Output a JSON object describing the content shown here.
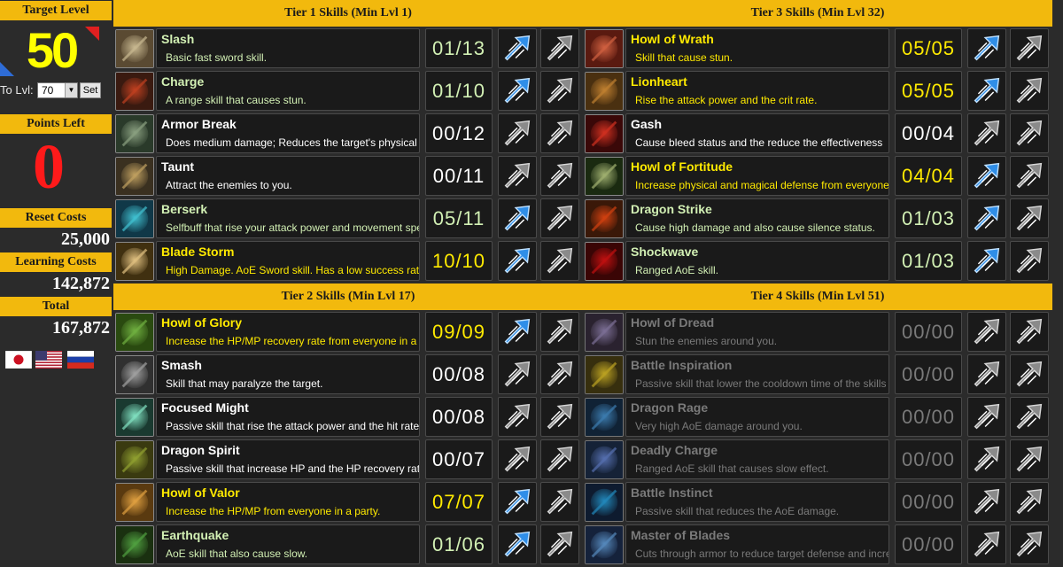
{
  "sidebar": {
    "target_level_label": "Target Level",
    "target_level": "50",
    "to_lvl_label": "To Lvl:",
    "to_lvl_value": "70",
    "set_label": "Set",
    "points_left_label": "Points Left",
    "points_left": "0",
    "reset_costs_label": "Reset Costs",
    "reset_costs": "25,000",
    "learning_costs_label": "Learning Costs",
    "learning_costs": "142,872",
    "total_label": "Total",
    "total": "167,872",
    "flags": [
      "japan-flag",
      "usa-flag",
      "russia-flag"
    ]
  },
  "colors": {
    "header_gold": "#f2b90d",
    "maxed_text": "#ffea00",
    "learned_text": "#d2f0b4",
    "locked_text": "#7a7a7a",
    "active_arrow": "#2f8ee8",
    "inactive_arrow": "#8a8a8a"
  },
  "tiers": [
    {
      "title": "Tier 1 Skills (Min Lvl 1)",
      "skills": [
        {
          "name": "Slash",
          "desc": "Basic fast sword skill.",
          "count": "01/13",
          "icon": "sword-slash-icon"
        },
        {
          "name": "Charge",
          "desc": "A range skill that causes stun.",
          "count": "01/10",
          "icon": "charge-icon"
        },
        {
          "name": "Armor Break",
          "desc": "Does medium damage; Reduces the target's physical",
          "count": "00/12",
          "icon": "armor-break-icon"
        },
        {
          "name": "Taunt",
          "desc": "Attract the enemies to you.",
          "count": "00/11",
          "icon": "taunt-icon"
        },
        {
          "name": "Berserk",
          "desc": "Selfbuff that rise your attack power and movement speed",
          "count": "05/11",
          "icon": "berserk-icon"
        },
        {
          "name": "Blade Storm",
          "desc": "High Damage. AoE Sword skill. Has a low success rate",
          "count": "10/10",
          "icon": "blade-storm-icon"
        }
      ]
    },
    {
      "title": "Tier 2 Skills (Min Lvl 17)",
      "skills": [
        {
          "name": "Howl of Glory",
          "desc": "Increase the HP/MP recovery rate from everyone in a party",
          "count": "09/09",
          "icon": "howl-of-glory-icon"
        },
        {
          "name": "Smash",
          "desc": "Skill that may paralyze the target.",
          "count": "00/08",
          "icon": "smash-icon"
        },
        {
          "name": "Focused Might",
          "desc": "Passive skill that rise the attack power and the hit rate",
          "count": "00/08",
          "icon": "focused-might-icon"
        },
        {
          "name": "Dragon Spirit",
          "desc": "Passive skill that increase HP and the HP recovery rate",
          "count": "00/07",
          "icon": "dragon-spirit-icon"
        },
        {
          "name": "Howl of Valor",
          "desc": "Increase the HP/MP from everyone in a party.",
          "count": "07/07",
          "icon": "howl-of-valor-icon"
        },
        {
          "name": "Earthquake",
          "desc": "AoE skill that also cause slow.",
          "count": "01/06",
          "icon": "earthquake-icon"
        }
      ]
    },
    {
      "title": "Tier 3 Skills (Min Lvl 32)",
      "skills": [
        {
          "name": "Howl of Wrath",
          "desc": "Skill that cause stun.",
          "count": "05/05",
          "icon": "howl-of-wrath-icon"
        },
        {
          "name": "Lionheart",
          "desc": "Rise the attack power and the crit rate.",
          "count": "05/05",
          "icon": "lionheart-icon"
        },
        {
          "name": "Gash",
          "desc": "Cause bleed status and the reduce the effectiveness",
          "count": "00/04",
          "icon": "gash-icon"
        },
        {
          "name": "Howl of Fortitude",
          "desc": "Increase physical and magical defense from everyone",
          "count": "04/04",
          "icon": "howl-of-fortitude-icon"
        },
        {
          "name": "Dragon Strike",
          "desc": "Cause high damage and also cause silence status.",
          "count": "01/03",
          "icon": "dragon-strike-icon"
        },
        {
          "name": "Shockwave",
          "desc": "Ranged AoE skill.",
          "count": "01/03",
          "icon": "shockwave-icon"
        }
      ]
    },
    {
      "title": "Tier 4 Skills (Min Lvl 51)",
      "skills": [
        {
          "name": "Howl of Dread",
          "desc": "Stun the enemies around you.",
          "count": "00/00",
          "icon": "howl-of-dread-icon"
        },
        {
          "name": "Battle Inspiration",
          "desc": "Passive skill that lower the cooldown time of the skills",
          "count": "00/00",
          "icon": "battle-inspiration-icon"
        },
        {
          "name": "Dragon Rage",
          "desc": "Very high AoE damage around you.",
          "count": "00/00",
          "icon": "dragon-rage-icon"
        },
        {
          "name": "Deadly Charge",
          "desc": "Ranged AoE skill that causes slow effect.",
          "count": "00/00",
          "icon": "deadly-charge-icon"
        },
        {
          "name": "Battle Instinct",
          "desc": "Passive skill that reduces the AoE damage.",
          "count": "00/00",
          "icon": "battle-instinct-icon"
        },
        {
          "name": "Master of Blades",
          "desc": "Cuts through armor to reduce target defense and increase",
          "count": "00/00",
          "icon": "master-of-blades-icon"
        }
      ]
    }
  ]
}
